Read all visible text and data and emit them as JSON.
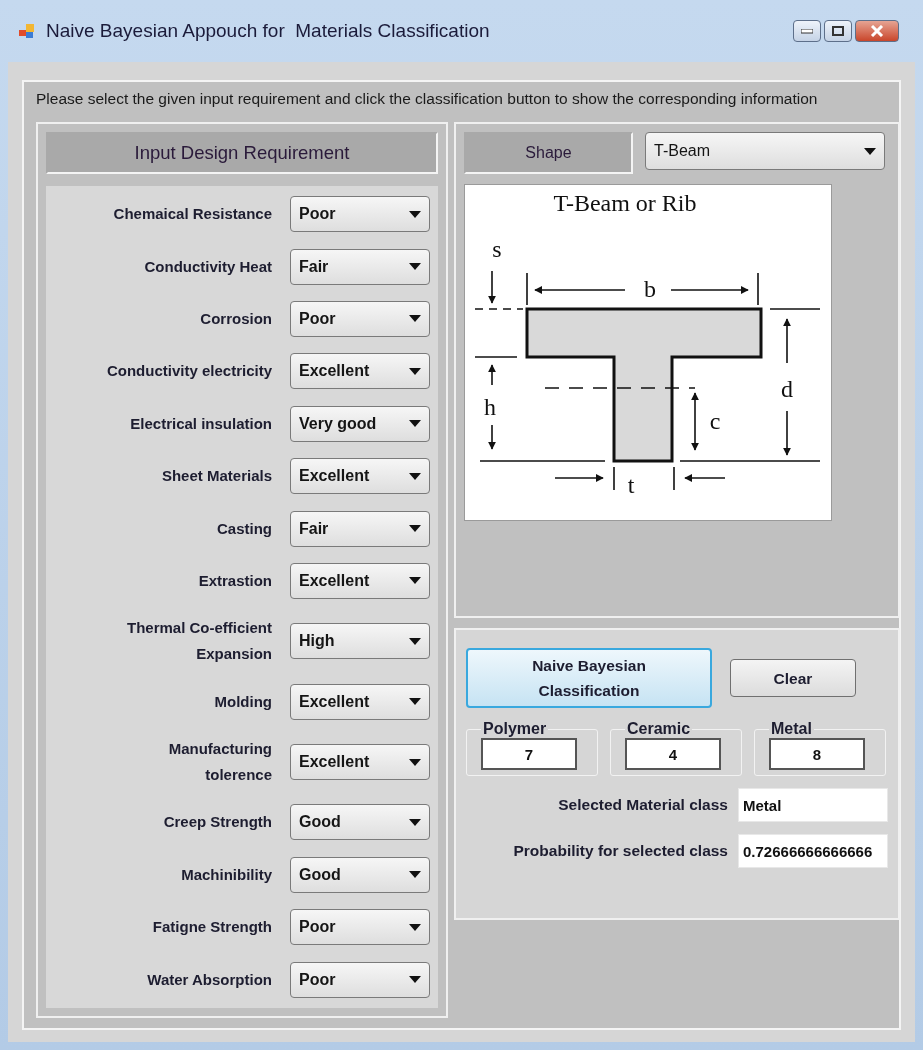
{
  "window": {
    "title": "Naive Bayesian Appouch for  Materials Classification"
  },
  "instructions": "Please select the given input requirement and click the classification button to show the corresponding information",
  "input_panel": {
    "title": "Input Design Requirement",
    "requirements": [
      {
        "label": "Chemaical Resistance",
        "value": "Poor"
      },
      {
        "label": "Conductivity Heat",
        "value": "Fair"
      },
      {
        "label": "Corrosion",
        "value": "Poor"
      },
      {
        "label": "Conductivity electricity",
        "value": "Excellent"
      },
      {
        "label": "Electrical insulation",
        "value": "Very good"
      },
      {
        "label": "Sheet Materials",
        "value": "Excellent"
      },
      {
        "label": "Casting",
        "value": "Fair"
      },
      {
        "label": "Extrastion",
        "value": "Excellent"
      },
      {
        "label": "Thermal Co-efficient\nExpansion",
        "value": "High"
      },
      {
        "label": "Molding",
        "value": "Excellent"
      },
      {
        "label": "Manufacturing\ntolerence",
        "value": "Excellent"
      },
      {
        "label": "Creep Strength",
        "value": "Good"
      },
      {
        "label": "Machinibility",
        "value": "Good"
      },
      {
        "label": "Fatigne Strength",
        "value": "Poor"
      },
      {
        "label": "Water Absorption",
        "value": "Poor"
      }
    ]
  },
  "shape": {
    "label": "Shape",
    "value": "T-Beam",
    "diagram": {
      "title": "T-Beam or Rib",
      "labels": [
        "s",
        "b",
        "h",
        "d",
        "c",
        "t"
      ]
    }
  },
  "actions": [
    {
      "label": "Naive Bayesian Classification",
      "focused": true
    },
    {
      "label": "Clear",
      "focused": false
    }
  ],
  "class_counts": [
    {
      "name": "Polymer",
      "value": "7"
    },
    {
      "name": "Ceramic",
      "value": "4"
    },
    {
      "name": "Metal",
      "value": "8"
    }
  ],
  "result_fields": [
    {
      "label": "Selected Material class",
      "value": "Metal"
    },
    {
      "label": "Probability for selected class",
      "value": "0.72666666666666"
    }
  ]
}
